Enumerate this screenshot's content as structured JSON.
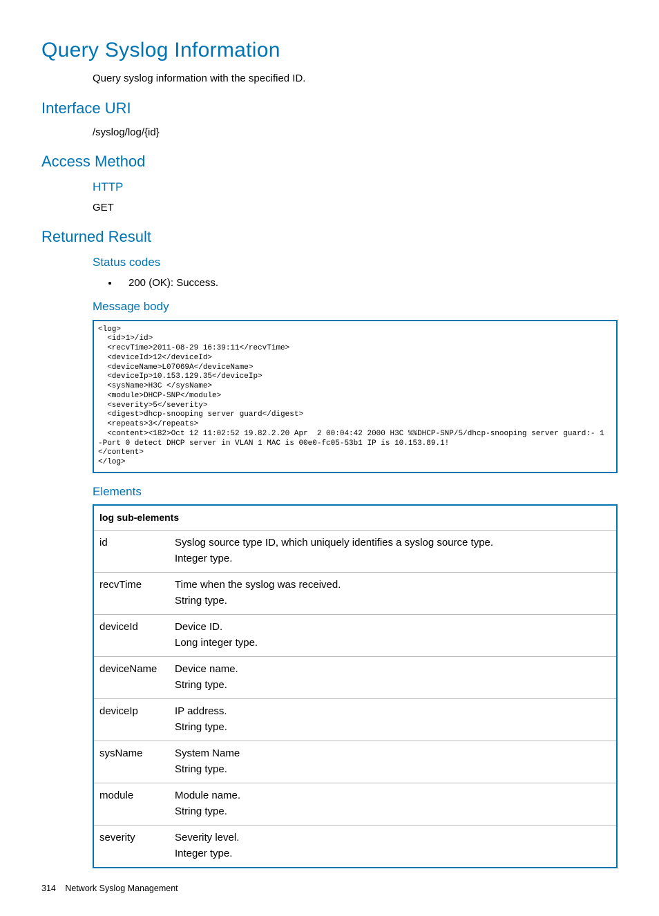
{
  "title": "Query Syslog Information",
  "intro": "Query syslog information with the specified ID.",
  "sections": {
    "interface_uri": {
      "heading": "Interface URI",
      "value": "/syslog/log/{id}"
    },
    "access_method": {
      "heading": "Access Method",
      "sub_http": "HTTP",
      "http_value": "GET"
    },
    "returned_result": {
      "heading": "Returned Result",
      "status_heading": "Status codes",
      "status_items": [
        "200 (OK): Success."
      ],
      "body_heading": "Message body",
      "code": "<log>\n  <id>1>/id>\n  <recvTime>2011-08-29 16:39:11</recvTime>\n  <deviceId>12</deviceId>\n  <deviceName>L07069A</deviceName>\n  <deviceIp>10.153.129.35</deviceIp>\n  <sysName>H3C </sysName>\n  <module>DHCP-SNP</module>\n  <severity>5</severity>\n  <digest>dhcp-snooping server guard</digest>\n  <repeats>3</repeats>\n  <content><182>Oct 12 11:02:52 19.82.2.20 Apr  2 00:04:42 2000 H3C %%DHCP-SNP/5/dhcp-snooping server guard:- 1 -Port 0 detect DHCP server in VLAN 1 MAC is 00e0-fc05-53b1 IP is 10.153.89.1!\n</content>\n</log>",
      "elements_heading": "Elements",
      "table_header": "log sub-elements",
      "rows": [
        {
          "name": "id",
          "desc1": "Syslog source type ID, which uniquely identifies a syslog source type.",
          "desc2": "Integer type."
        },
        {
          "name": "recvTime",
          "desc1": "Time when the syslog was received.",
          "desc2": "String type."
        },
        {
          "name": "deviceId",
          "desc1": "Device ID.",
          "desc2": "Long integer type."
        },
        {
          "name": "deviceName",
          "desc1": "Device name.",
          "desc2": "String type."
        },
        {
          "name": "deviceIp",
          "desc1": "IP address.",
          "desc2": "String type."
        },
        {
          "name": "sysName",
          "desc1": "System Name",
          "desc2": "String type."
        },
        {
          "name": "module",
          "desc1": "Module name.",
          "desc2": "String type."
        },
        {
          "name": "severity",
          "desc1": "Severity level.",
          "desc2": "Integer type."
        }
      ]
    }
  },
  "footer": {
    "page": "314",
    "chapter": "Network Syslog Management"
  }
}
